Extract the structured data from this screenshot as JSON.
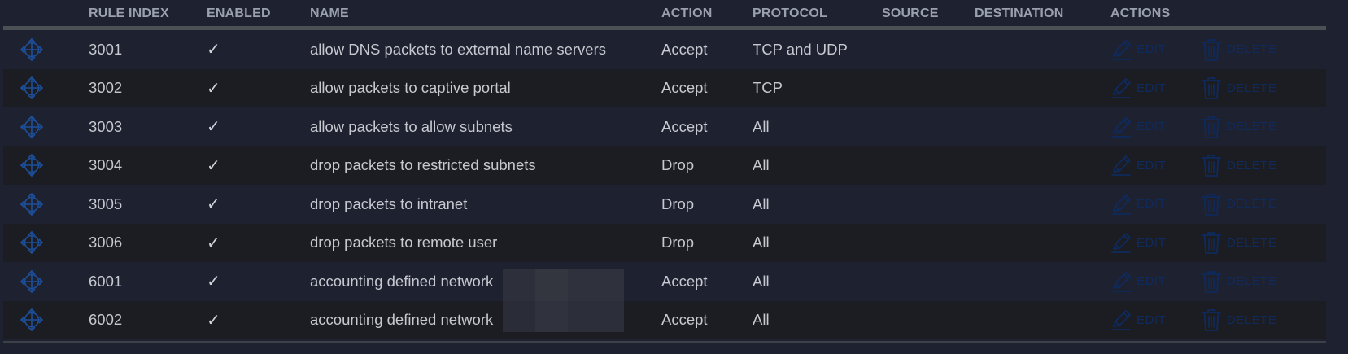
{
  "table": {
    "headers": {
      "rule_index": "RULE INDEX",
      "enabled": "ENABLED",
      "name": "NAME",
      "action": "ACTION",
      "protocol": "PROTOCOL",
      "source": "SOURCE",
      "destination": "DESTINATION",
      "actions": "ACTIONS"
    },
    "edit_label": "EDIT",
    "delete_label": "DELETE",
    "enabled_glyph": "✓",
    "rows": [
      {
        "index": "3001",
        "name": "allow DNS packets to external name servers",
        "action": "Accept",
        "protocol": "TCP and UDP"
      },
      {
        "index": "3002",
        "name": "allow packets to captive portal",
        "action": "Accept",
        "protocol": "TCP"
      },
      {
        "index": "3003",
        "name": "allow packets to allow subnets",
        "action": "Accept",
        "protocol": "All"
      },
      {
        "index": "3004",
        "name": "drop packets to restricted subnets",
        "action": "Drop",
        "protocol": "All"
      },
      {
        "index": "3005",
        "name": "drop packets to intranet",
        "action": "Drop",
        "protocol": "All"
      },
      {
        "index": "3006",
        "name": "drop packets to remote user",
        "action": "Drop",
        "protocol": "All"
      },
      {
        "index": "6001",
        "name": "accounting defined network",
        "action": "Accept",
        "protocol": "All"
      },
      {
        "index": "6002",
        "name": "accounting defined network",
        "action": "Accept",
        "protocol": "All"
      }
    ]
  },
  "colors": {
    "background": "#1e2130",
    "alt_row": "#1c1d22",
    "header_text": "#9aa0ae",
    "cell_text": "#c6c9cf",
    "action_link": "#0f2a5c",
    "drag_icon": "#1d4f9a"
  },
  "icons": {
    "drag": "move-arrows-icon",
    "edit": "pencil-icon",
    "delete": "trash-icon"
  }
}
